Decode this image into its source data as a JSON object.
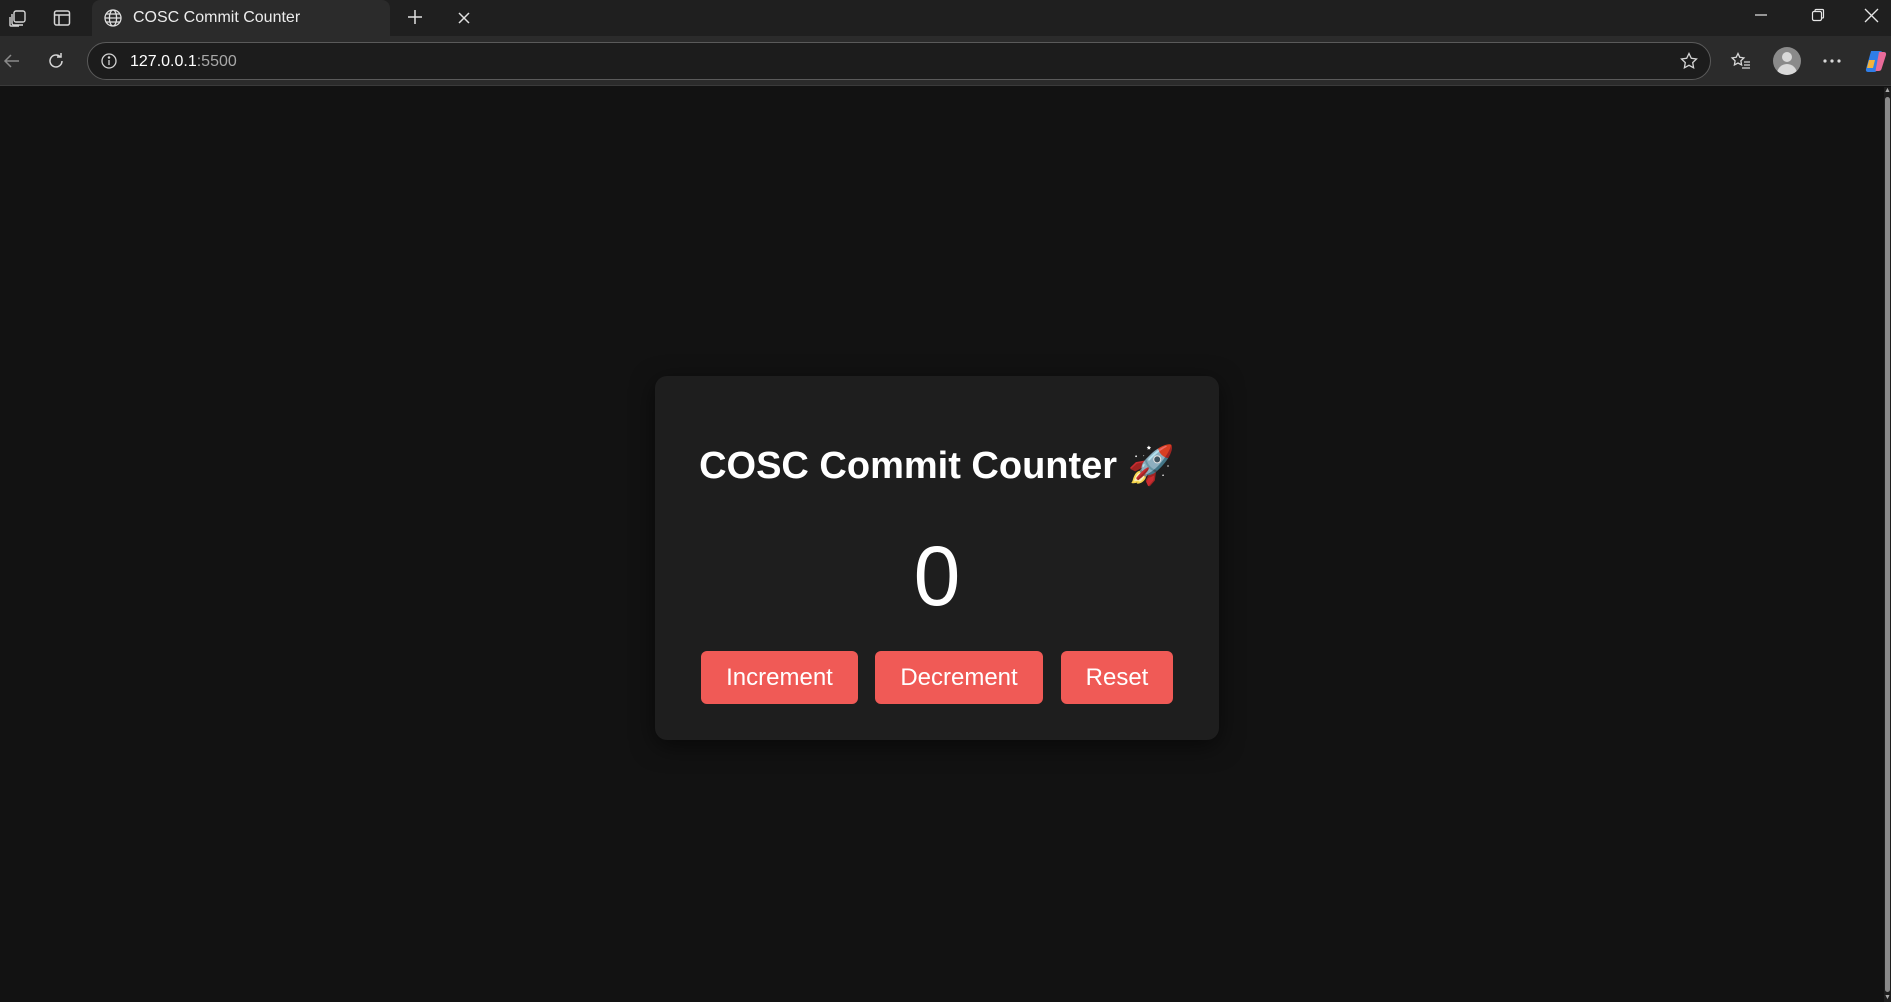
{
  "browser": {
    "tab_title": "COSC Commit Counter",
    "url_host": "127.0.0.1",
    "url_port": ":5500",
    "icons": {
      "workspaces": "workspaces-icon",
      "tab_actions": "tab-actions-icon",
      "tab_favicon": "globe-icon",
      "tab_close": "close-icon",
      "new_tab": "plus-icon",
      "minimize": "minimize-icon",
      "restore": "restore-icon",
      "close_window": "close-icon",
      "back": "back-arrow-icon",
      "refresh": "refresh-icon",
      "site_info": "info-icon",
      "favorite": "star-icon",
      "favorites": "favorites-icon",
      "profile": "profile-icon",
      "more": "more-icon",
      "copilot": "copilot-icon"
    }
  },
  "app": {
    "title": "COSC Commit Counter 🚀",
    "count": "0",
    "buttons": {
      "increment": "Increment",
      "decrement": "Decrement",
      "reset": "Reset"
    }
  },
  "colors": {
    "page_background": "#121212",
    "card_background": "#1e1e1e",
    "button_accent": "#f05a56",
    "text": "#ffffff"
  }
}
